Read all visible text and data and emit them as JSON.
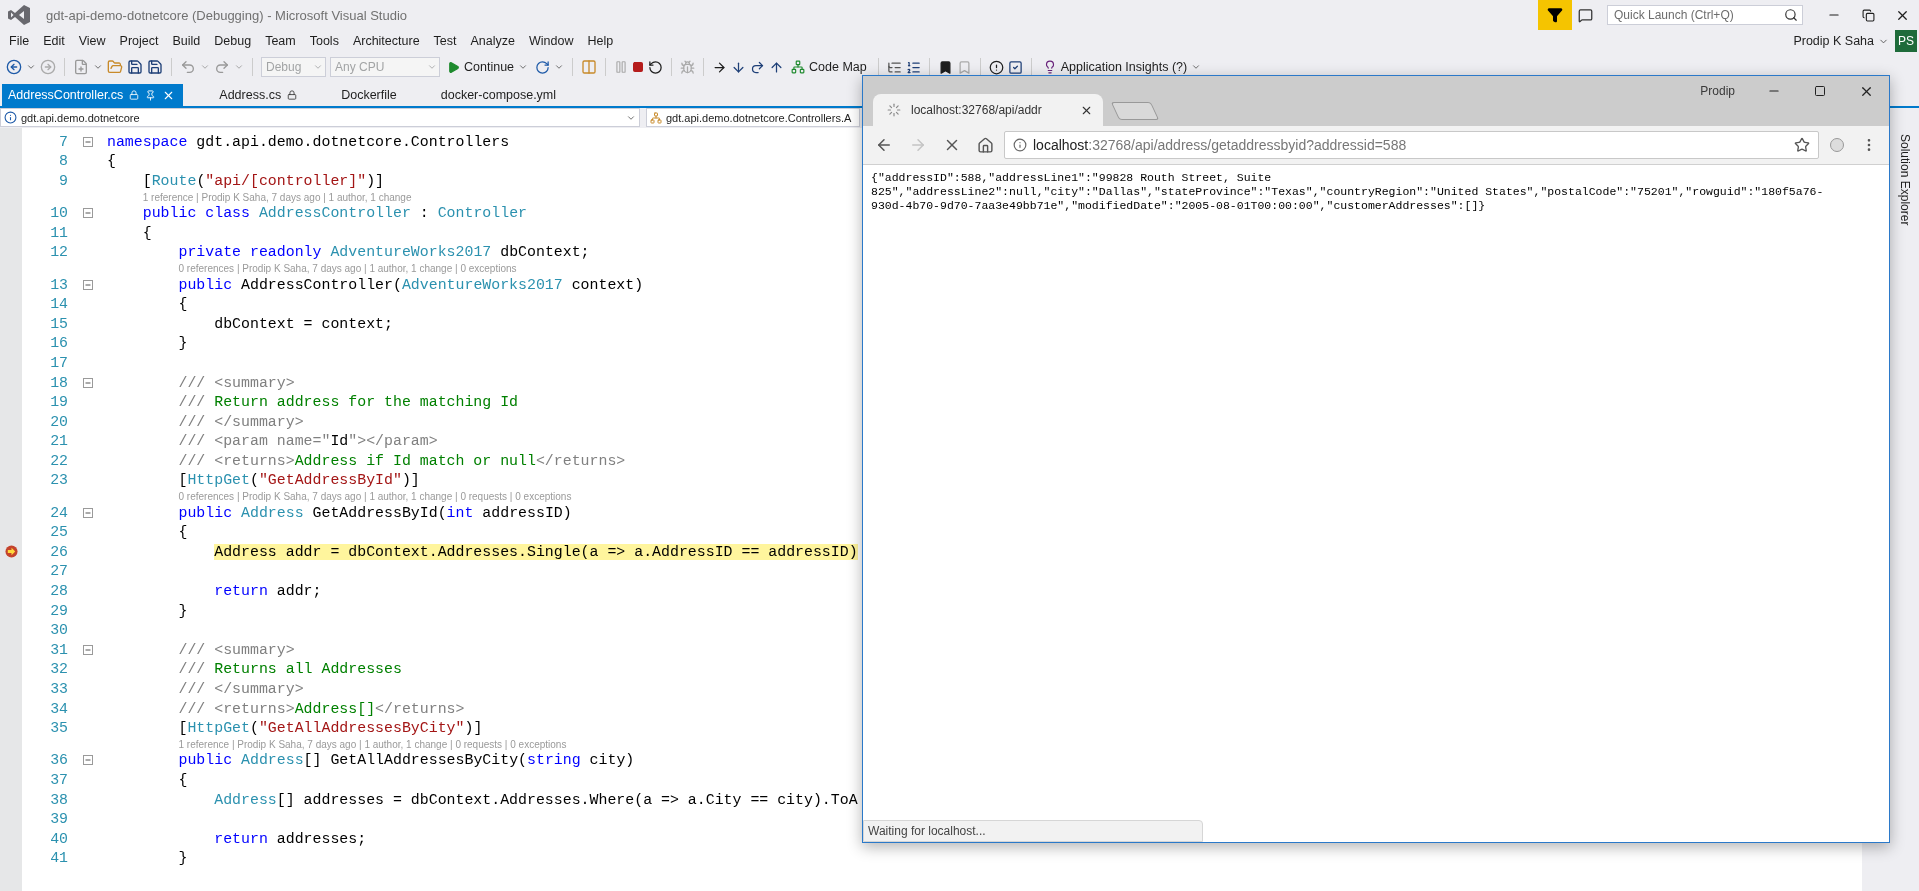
{
  "window": {
    "title": "gdt-api-demo-dotnetcore (Debugging) - Microsoft Visual Studio",
    "quick_launch": {
      "placeholder": "Quick Launch (Ctrl+Q)"
    }
  },
  "menu": [
    "File",
    "Edit",
    "View",
    "Project",
    "Build",
    "Debug",
    "Team",
    "Tools",
    "Architecture",
    "Test",
    "Analyze",
    "Window",
    "Help"
  ],
  "account": {
    "name": "Prodip K Saha",
    "initials": "PS"
  },
  "toolbar": {
    "configuration": {
      "value": "Debug",
      "disabled": true
    },
    "platform": {
      "value": "Any CPU",
      "disabled": true
    },
    "continue": "Continue",
    "code_map": "Code Map",
    "insights": "Application Insights (?)"
  },
  "tabs": [
    {
      "label": "AddressController.cs",
      "selected": true,
      "locked": true
    },
    {
      "label": "Address.cs",
      "selected": false,
      "locked": true
    },
    {
      "label": "Dockerfile",
      "selected": false,
      "locked": false
    },
    {
      "label": "docker-compose.yml",
      "selected": false,
      "locked": false
    }
  ],
  "navigation": [
    "gdt.api.demo.dotnetcore",
    "gdt.api.demo.dotnetcore.Controllers.A"
  ],
  "editor": {
    "lines": [
      {
        "kind": "code",
        "number": "7",
        "foldable": true,
        "current": false,
        "tokens": [
          {
            "kind": "keyword",
            "text": "namespace"
          },
          {
            "kind": "plain",
            "text": " gdt.api.demo.dotnetcore.Controllers"
          }
        ]
      },
      {
        "kind": "code",
        "number": "8",
        "foldable": false,
        "current": false,
        "tokens": [
          {
            "kind": "plain",
            "text": "{"
          }
        ]
      },
      {
        "kind": "code",
        "number": "9",
        "foldable": false,
        "current": false,
        "tokens": [
          {
            "kind": "plain",
            "text": "    ["
          },
          {
            "kind": "type",
            "text": "Route"
          },
          {
            "kind": "plain",
            "text": "("
          },
          {
            "kind": "string",
            "text": "\"api/[controller]\""
          },
          {
            "kind": "plain",
            "text": ")]"
          }
        ]
      },
      {
        "kind": "lens",
        "text": "1 reference | Prodip K Saha, 7 days ago | 1 author, 1 change"
      },
      {
        "kind": "code",
        "number": "10",
        "foldable": true,
        "current": false,
        "tokens": [
          {
            "kind": "keyword",
            "text": "    public class "
          },
          {
            "kind": "type",
            "text": "AddressController"
          },
          {
            "kind": "plain",
            "text": " : "
          },
          {
            "kind": "type",
            "text": "Controller"
          }
        ]
      },
      {
        "kind": "code",
        "number": "11",
        "foldable": false,
        "current": false,
        "tokens": [
          {
            "kind": "plain",
            "text": "    {"
          }
        ]
      },
      {
        "kind": "code",
        "number": "12",
        "foldable": false,
        "current": false,
        "tokens": [
          {
            "kind": "keyword",
            "text": "        private readonly "
          },
          {
            "kind": "type",
            "text": "AdventureWorks2017"
          },
          {
            "kind": "plain",
            "text": " dbContext;"
          }
        ]
      },
      {
        "kind": "lens",
        "text": "0 references | Prodip K Saha, 7 days ago | 1 author, 1 change | 0 exceptions"
      },
      {
        "kind": "code",
        "number": "13",
        "foldable": true,
        "current": false,
        "tokens": [
          {
            "kind": "keyword",
            "text": "        public"
          },
          {
            "kind": "plain",
            "text": " AddressController("
          },
          {
            "kind": "type",
            "text": "AdventureWorks2017"
          },
          {
            "kind": "plain",
            "text": " context)"
          }
        ]
      },
      {
        "kind": "code",
        "number": "14",
        "foldable": false,
        "current": false,
        "tokens": [
          {
            "kind": "plain",
            "text": "        {"
          }
        ]
      },
      {
        "kind": "code",
        "number": "15",
        "foldable": false,
        "current": false,
        "tokens": [
          {
            "kind": "plain",
            "text": "            dbContext = context;"
          }
        ]
      },
      {
        "kind": "code",
        "number": "16",
        "foldable": false,
        "current": false,
        "tokens": [
          {
            "kind": "plain",
            "text": "        }"
          }
        ]
      },
      {
        "kind": "code",
        "number": "17",
        "foldable": false,
        "current": false
      },
      {
        "kind": "code",
        "number": "18",
        "foldable": true,
        "current": false,
        "tokens": [
          {
            "kind": "doc",
            "text": "        /// <summary>"
          }
        ]
      },
      {
        "kind": "code",
        "number": "19",
        "foldable": false,
        "current": false,
        "tokens": [
          {
            "kind": "doc",
            "text": "        ///"
          },
          {
            "kind": "comment",
            "text": " Return address for the matching Id"
          }
        ]
      },
      {
        "kind": "code",
        "number": "20",
        "foldable": false,
        "current": false,
        "tokens": [
          {
            "kind": "doc",
            "text": "        /// </summary>"
          }
        ]
      },
      {
        "kind": "code",
        "number": "21",
        "foldable": false,
        "current": false,
        "tokens": [
          {
            "kind": "doc",
            "text": "        /// <param name=\""
          },
          {
            "kind": "plain",
            "text": "Id"
          },
          {
            "kind": "doc",
            "text": "\"></param>"
          }
        ]
      },
      {
        "kind": "code",
        "number": "22",
        "foldable": false,
        "current": false,
        "tokens": [
          {
            "kind": "doc",
            "text": "        /// <returns>"
          },
          {
            "kind": "comment",
            "text": "Address if Id match or null"
          },
          {
            "kind": "doc",
            "text": "</returns>"
          }
        ]
      },
      {
        "kind": "code",
        "number": "23",
        "foldable": false,
        "current": false,
        "tokens": [
          {
            "kind": "plain",
            "text": "        ["
          },
          {
            "kind": "type",
            "text": "HttpGet"
          },
          {
            "kind": "plain",
            "text": "("
          },
          {
            "kind": "string",
            "text": "\"GetAddressById\""
          },
          {
            "kind": "plain",
            "text": ")]"
          }
        ]
      },
      {
        "kind": "lens",
        "text": "0 references | Prodip K Saha, 7 days ago | 1 author, 1 change | 0 requests | 0 exceptions"
      },
      {
        "kind": "code",
        "number": "24",
        "foldable": true,
        "current": false,
        "tokens": [
          {
            "kind": "keyword",
            "text": "        public "
          },
          {
            "kind": "type",
            "text": "Address"
          },
          {
            "kind": "plain",
            "text": " GetAddressById("
          },
          {
            "kind": "keyword",
            "text": "int"
          },
          {
            "kind": "plain",
            "text": " addressID)"
          }
        ]
      },
      {
        "kind": "code",
        "number": "25",
        "foldable": false,
        "current": false,
        "tokens": [
          {
            "kind": "plain",
            "text": "        {"
          }
        ]
      },
      {
        "kind": "code",
        "number": "26",
        "foldable": false,
        "current": true,
        "tokens": [
          {
            "kind": "plain",
            "text": "            Address addr = dbContext.Addresses.Single(a => a.AddressID == addressID)"
          }
        ]
      },
      {
        "kind": "code",
        "number": "27",
        "foldable": false,
        "current": false
      },
      {
        "kind": "code",
        "number": "28",
        "foldable": false,
        "current": false,
        "tokens": [
          {
            "kind": "keyword",
            "text": "            return"
          },
          {
            "kind": "plain",
            "text": " addr;"
          }
        ]
      },
      {
        "kind": "code",
        "number": "29",
        "foldable": false,
        "current": false,
        "tokens": [
          {
            "kind": "plain",
            "text": "        }"
          }
        ]
      },
      {
        "kind": "code",
        "number": "30",
        "foldable": false,
        "current": false
      },
      {
        "kind": "code",
        "number": "31",
        "foldable": true,
        "current": false,
        "tokens": [
          {
            "kind": "doc",
            "text": "        /// <summary>"
          }
        ]
      },
      {
        "kind": "code",
        "number": "32",
        "foldable": false,
        "current": false,
        "tokens": [
          {
            "kind": "doc",
            "text": "        ///"
          },
          {
            "kind": "comment",
            "text": " Returns all Addresses"
          }
        ]
      },
      {
        "kind": "code",
        "number": "33",
        "foldable": false,
        "current": false,
        "tokens": [
          {
            "kind": "doc",
            "text": "        /// </summary>"
          }
        ]
      },
      {
        "kind": "code",
        "number": "34",
        "foldable": false,
        "current": false,
        "tokens": [
          {
            "kind": "doc",
            "text": "        /// <returns>"
          },
          {
            "kind": "comment",
            "text": "Address[]"
          },
          {
            "kind": "doc",
            "text": "</returns>"
          }
        ]
      },
      {
        "kind": "code",
        "number": "35",
        "foldable": false,
        "current": false,
        "tokens": [
          {
            "kind": "plain",
            "text": "        ["
          },
          {
            "kind": "type",
            "text": "HttpGet"
          },
          {
            "kind": "plain",
            "text": "("
          },
          {
            "kind": "string",
            "text": "\"GetAllAddressesByCity\""
          },
          {
            "kind": "plain",
            "text": ")]"
          }
        ]
      },
      {
        "kind": "lens",
        "text": "1 reference | Prodip K Saha, 7 days ago | 1 author, 1 change | 0 requests | 0 exceptions"
      },
      {
        "kind": "code",
        "number": "36",
        "foldable": true,
        "current": false,
        "tokens": [
          {
            "kind": "keyword",
            "text": "        public "
          },
          {
            "kind": "type",
            "text": "Address"
          },
          {
            "kind": "plain",
            "text": "[] GetAllAddressesByCity("
          },
          {
            "kind": "keyword",
            "text": "string"
          },
          {
            "kind": "plain",
            "text": " city)"
          }
        ]
      },
      {
        "kind": "code",
        "number": "37",
        "foldable": false,
        "current": false,
        "tokens": [
          {
            "kind": "plain",
            "text": "        {"
          }
        ]
      },
      {
        "kind": "code",
        "number": "38",
        "foldable": false,
        "current": false,
        "tokens": [
          {
            "kind": "type",
            "text": "            Address"
          },
          {
            "kind": "plain",
            "text": "[] addresses = dbContext.Addresses.Where(a => a.City == city).ToA"
          }
        ]
      },
      {
        "kind": "code",
        "number": "39",
        "foldable": false,
        "current": false
      },
      {
        "kind": "code",
        "number": "40",
        "foldable": false,
        "current": false,
        "tokens": [
          {
            "kind": "keyword",
            "text": "            return"
          },
          {
            "kind": "plain",
            "text": " addresses;"
          }
        ]
      },
      {
        "kind": "code",
        "number": "41",
        "foldable": false,
        "current": false,
        "tokens": [
          {
            "kind": "plain",
            "text": "        }"
          }
        ]
      }
    ]
  },
  "side_tab": "Solution Explorer",
  "browser": {
    "profile": "Prodip",
    "tab": {
      "title": "localhost:32768/api/addr",
      "loading": true
    },
    "address": {
      "host": "localhost",
      "path": ":32768/api/address/getaddressbyid?addressid=588"
    },
    "body": [
      "{\"addressID\":588,\"addressLine1\":\"99828 Routh Street, Suite",
      "825\",\"addressLine2\":null,\"city\":\"Dallas\",\"stateProvince\":\"Texas\",\"countryRegion\":\"United States\",\"postalCode\":\"75201\",\"rowguid\":\"180f5a76-",
      "930d-4b70-9d70-7aa3e49bb71e\",\"modifiedDate\":\"2005-08-01T00:00:00\",\"customerAddresses\":[]}"
    ],
    "status": "Waiting for localhost..."
  }
}
